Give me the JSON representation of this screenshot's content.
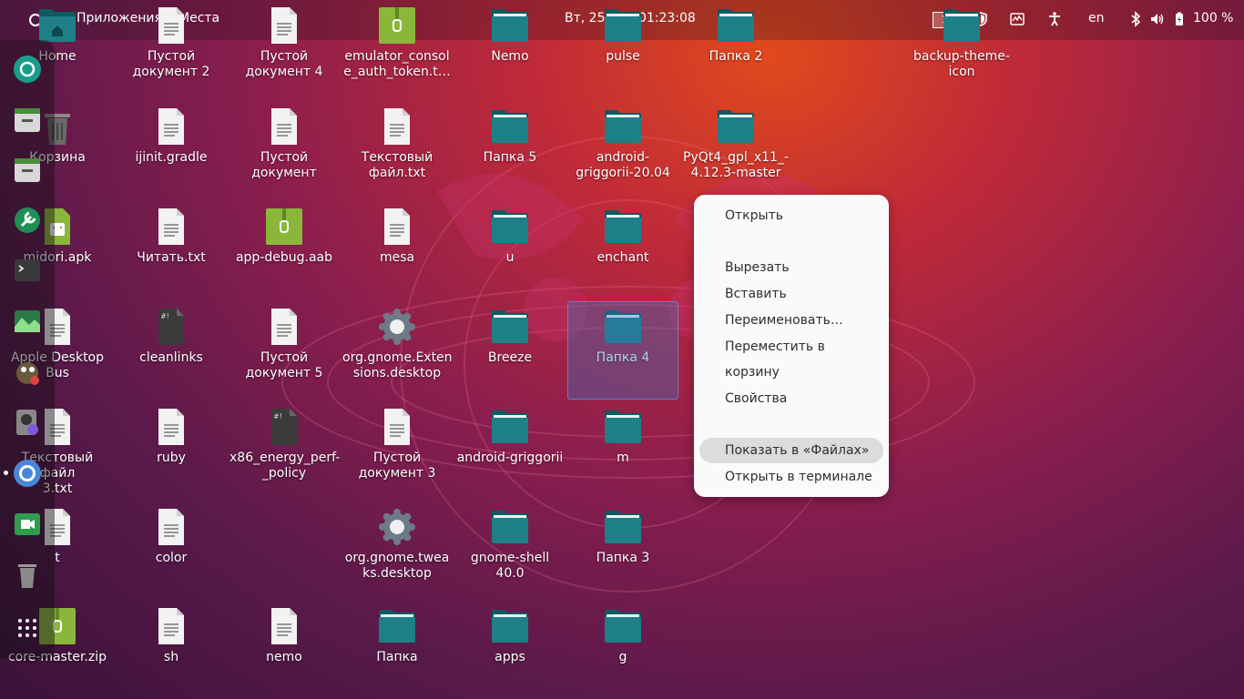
{
  "topbar": {
    "apps_label": "Приложения",
    "places_label": "Места",
    "clock": "Вт, 25 мая  01:23:08",
    "workspace": "1",
    "lang": "en",
    "battery": "100 %"
  },
  "dock": {
    "items": [
      "camera-icon",
      "files-icon",
      "files-icon",
      "settings-icon",
      "terminal-icon",
      "image-viewer-icon",
      "gimp-icon",
      "disk-usage-icon",
      "chromium-icon",
      "screencast-icon",
      "trash-icon",
      "app-grid-icon"
    ]
  },
  "desktop": {
    "items": [
      {
        "label": "Home",
        "icon": "home-folder"
      },
      {
        "label": "Пустой\nдокумент 2",
        "icon": "text-file"
      },
      {
        "label": "Пустой\nдокумент 4",
        "icon": "text-file"
      },
      {
        "label": "emulator_consol\ne_auth_token.t…",
        "icon": "archive"
      },
      {
        "label": "Nemo",
        "icon": "folder"
      },
      {
        "label": "pulse",
        "icon": "folder"
      },
      {
        "label": "Папка 2",
        "icon": "folder"
      },
      {
        "label": "backup-theme-\nicon",
        "icon": "folder"
      },
      {
        "label": "Корзина",
        "icon": "trash"
      },
      {
        "label": "ijinit.gradle",
        "icon": "text-file"
      },
      {
        "label": "Пустой документ",
        "icon": "text-file"
      },
      {
        "label": "Текстовый\nфайл.txt",
        "icon": "text-file"
      },
      {
        "label": "Папка 5",
        "icon": "folder"
      },
      {
        "label": "android-\ngriggorii-20.04",
        "icon": "folder"
      },
      {
        "label": "PyQt4_gpl_x11_-\n4.12.3-master",
        "icon": "folder"
      },
      {
        "label": "midori.apk",
        "icon": "android-package"
      },
      {
        "label": "Читать.txt",
        "icon": "text-file"
      },
      {
        "label": "app-debug.aab",
        "icon": "archive"
      },
      {
        "label": "mesa",
        "icon": "text-file"
      },
      {
        "label": "u",
        "icon": "folder"
      },
      {
        "label": "enchant",
        "icon": "folder"
      },
      {
        "label": "Apple Desktop\nBus",
        "icon": "text-file"
      },
      {
        "label": "cleanlinks",
        "icon": "script"
      },
      {
        "label": "Пустой\nдокумент 5",
        "icon": "text-file"
      },
      {
        "label": "org.gnome.Exten\nsions.desktop",
        "icon": "gear"
      },
      {
        "label": "Breeze",
        "icon": "folder"
      },
      {
        "label": "Папка 4",
        "icon": "folder"
      },
      {
        "label": "Текстовый файл\n3.txt",
        "icon": "text-file"
      },
      {
        "label": "ruby",
        "icon": "text-file"
      },
      {
        "label": "x86_energy_perf-\n_policy",
        "icon": "script"
      },
      {
        "label": "Пустой\nдокумент 3",
        "icon": "text-file"
      },
      {
        "label": "android-griggorii",
        "icon": "folder"
      },
      {
        "label": "m",
        "icon": "folder"
      },
      {
        "label": "t",
        "icon": "text-file"
      },
      {
        "label": "color",
        "icon": "text-file"
      },
      {
        "label": "org.gnome.twea\nks.desktop",
        "icon": "gear"
      },
      {
        "label": "gnome-shell 40.0",
        "icon": "folder"
      },
      {
        "label": "Папка 3",
        "icon": "folder"
      },
      {
        "label": "core-master.zip",
        "icon": "archive"
      },
      {
        "label": "sh",
        "icon": "text-file"
      },
      {
        "label": "nemo",
        "icon": "text-file"
      },
      {
        "label": "Папка",
        "icon": "folder"
      },
      {
        "label": "apps",
        "icon": "folder"
      },
      {
        "label": "g",
        "icon": "folder"
      }
    ]
  },
  "context_menu": {
    "items": [
      {
        "label": "Открыть"
      },
      {
        "label": "Вырезать"
      },
      {
        "label": "Вставить"
      },
      {
        "label": "Переименовать…"
      },
      {
        "label": "Переместить в корзину"
      },
      {
        "label": "Свойства"
      },
      {
        "label": "Показать в «Файлах»",
        "highlighted": true
      },
      {
        "label": "Открыть в терминале"
      }
    ]
  },
  "colors": {
    "folder": "#1f7f86",
    "folder_tab": "#0f5a60",
    "archive": "#8ab73a",
    "menu_bg": "#fafafa",
    "menu_highlight": "#dcdcdc"
  }
}
